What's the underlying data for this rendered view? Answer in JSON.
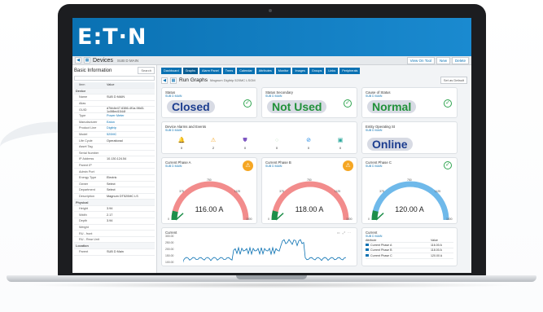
{
  "brand": {
    "logo_text": "E:T·N",
    "color": "#0a71b2"
  },
  "titlebar": {
    "back_icon": "arrow-left-icon",
    "home_icon": "grid-icon",
    "title": "Devices",
    "sub": "SUB D MAIN",
    "buttons": [
      "View On Tool",
      "New",
      "Delete"
    ]
  },
  "left": {
    "title": "Basic Information",
    "search_label": "Search",
    "head": {
      "k": "Item",
      "v": "Value"
    },
    "rows": [
      {
        "k": "Device",
        "v": "",
        "sec": true
      },
      {
        "k": "Name",
        "v": "SUB D MAIN"
      },
      {
        "k": "Alias",
        "v": ""
      },
      {
        "k": "GUID",
        "v": "d7bb4e47-6386-4f1a-98d3-1c0f8ed1544f"
      },
      {
        "k": "Type",
        "v": "Power Meter",
        "lnk": true
      },
      {
        "k": "Manufacturer",
        "v": "Eaton",
        "lnk": true
      },
      {
        "k": "Product Line",
        "v": "Digitrip",
        "lnk": true
      },
      {
        "k": "Model",
        "v": "520MC",
        "lnk": true
      },
      {
        "k": "Life Cycle",
        "v": "Operational"
      },
      {
        "k": "Asset Tag",
        "v": ""
      },
      {
        "k": "Serial Number",
        "v": ""
      },
      {
        "k": "IP Address",
        "v": "10.130.124.54"
      },
      {
        "k": "Parent IP",
        "v": ""
      },
      {
        "k": "Admin Port",
        "v": ""
      },
      {
        "k": "Energy Type",
        "v": "Electric"
      },
      {
        "k": "Owner",
        "v": "Select"
      },
      {
        "k": "Department",
        "v": "Select"
      },
      {
        "k": "Description",
        "v": "Magnum DT520MC LS"
      },
      {
        "k": "Physical",
        "v": "",
        "sec": true
      },
      {
        "k": "Height",
        "v": "3.94"
      },
      {
        "k": "Width",
        "v": "2.17"
      },
      {
        "k": "Depth",
        "v": "3.94"
      },
      {
        "k": "Weight",
        "v": ""
      },
      {
        "k": "RU - front",
        "v": ""
      },
      {
        "k": "RU - Rear Unit",
        "v": ""
      },
      {
        "k": "Location",
        "v": "",
        "sec": true
      },
      {
        "k": "Parent",
        "v": "SUB D Main"
      }
    ]
  },
  "tabs": [
    "Dashboard",
    "Graphs",
    "Alarm Panel",
    "Trees",
    "Calendar",
    "Attributes",
    "Monitor",
    "Images",
    "Groups",
    "Links",
    "Peripherals"
  ],
  "graphs": {
    "title": "Run Graphs",
    "sub": "Magnum Digitrip 520MC LSGM",
    "default_button": "Set as Default"
  },
  "status_cards": [
    {
      "title": "Status",
      "sub": "SUB D MAIN",
      "value": "Closed",
      "color": "#1c3d8f"
    },
    {
      "title": "Status Secondary",
      "sub": "SUB D MAIN",
      "value": "Not Used",
      "color": "#21913a"
    },
    {
      "title": "Cause of Status",
      "sub": "SUB D MAIN",
      "value": "Normal",
      "color": "#21913a"
    }
  ],
  "alarms": {
    "title": "Device Alarms and Events",
    "sub": "SUB D MAIN",
    "items": [
      {
        "icon": "bell-icon",
        "count": "0",
        "color": "#e53935"
      },
      {
        "icon": "warning-icon",
        "count": "2",
        "color": "#f5a623"
      },
      {
        "icon": "shield-icon",
        "count": "0",
        "color": "#7e57c2"
      },
      {
        "icon": "circle-icon",
        "count": "0",
        "color": "#c8e6c9"
      },
      {
        "icon": "slash-icon",
        "count": "0",
        "color": "#1e88e5"
      },
      {
        "icon": "tag-icon",
        "count": "0",
        "color": "#26a69a"
      }
    ]
  },
  "entity": {
    "title": "Entity Operating St",
    "sub": "SUB D MAIN",
    "value": "Online",
    "color": "#1c3d8f"
  },
  "gauges": [
    {
      "title": "Current Phase A",
      "sub": "SUB D MAIN",
      "value": "116.00 A",
      "level": 116,
      "max": 1500,
      "color": "#f28c8c",
      "alarm": true,
      "ticks": [
        "0",
        "375",
        "750",
        "1125",
        "1500"
      ]
    },
    {
      "title": "Current Phase B",
      "sub": "SUB D MAIN",
      "value": "118.00 A",
      "level": 118,
      "max": 1500,
      "color": "#f28c8c",
      "alarm": true,
      "ticks": [
        "0",
        "375",
        "750",
        "1125",
        "1500"
      ]
    },
    {
      "title": "Current Phase C",
      "sub": "SUB D MAIN",
      "value": "120.00 A",
      "level": 120,
      "max": 1500,
      "color": "#6fb9ea",
      "alarm": false,
      "ticks": [
        "0",
        "375",
        "750",
        "1125",
        "1500"
      ]
    }
  ],
  "current_chart": {
    "title": "Current",
    "y_ticks": [
      "300.00",
      "250.00",
      "200.00",
      "150.00",
      "100.00"
    ]
  },
  "current_table": {
    "title": "Current",
    "sub": "SUB D MAIN",
    "head": {
      "a": "Attribute",
      "b": "Value"
    },
    "rows": [
      {
        "a": "Current Phase A",
        "b": "116.00 A"
      },
      {
        "a": "Current Phase B",
        "b": "118.00 A"
      },
      {
        "a": "Current Phase C",
        "b": "120.00 A"
      }
    ]
  }
}
